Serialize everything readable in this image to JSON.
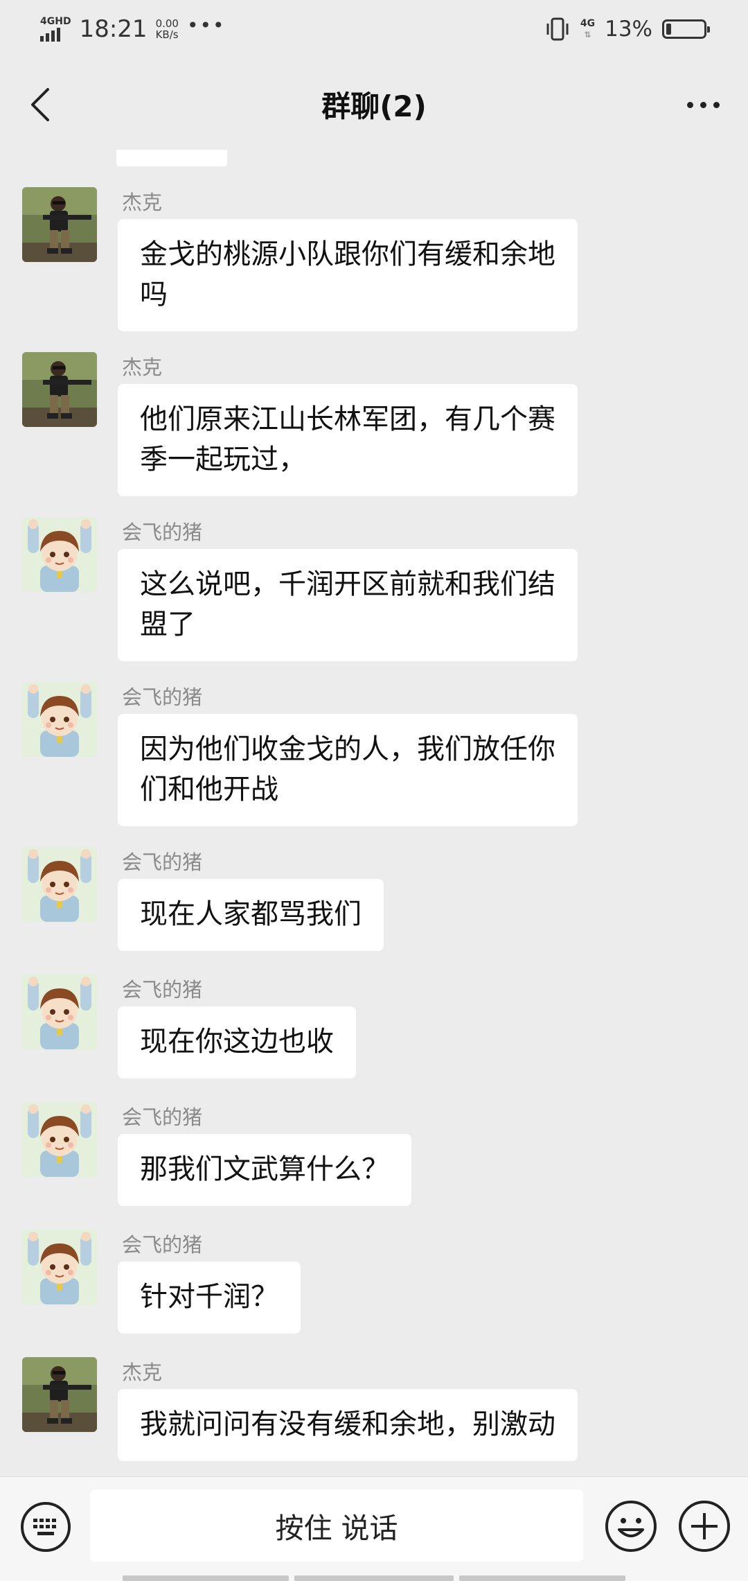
{
  "status_bar": {
    "network_label": "4GHD",
    "time": "18:21",
    "speed_value": "0.00",
    "speed_unit": "KB/s",
    "more_indicator": "•••",
    "mobile_net": "4G",
    "battery_percent": "13%",
    "battery_level": 0.13
  },
  "header": {
    "title": "群聊(2)"
  },
  "messages": [
    {
      "sender": "杰克",
      "avatar": "jack",
      "text_lines": [
        "金戈的桃源小队跟你们有缓和余地",
        "吗"
      ]
    },
    {
      "sender": "杰克",
      "avatar": "jack",
      "text_lines": [
        "他们原来江山长林军团，有几个赛",
        "季一起玩过，"
      ]
    },
    {
      "sender": "会飞的猪",
      "avatar": "pig",
      "text_lines": [
        "这么说吧，千润开区前就和我们结",
        "盟了"
      ]
    },
    {
      "sender": "会飞的猪",
      "avatar": "pig",
      "text_lines": [
        "因为他们收金戈的人，我们放任你",
        "们和他开战"
      ]
    },
    {
      "sender": "会飞的猪",
      "avatar": "pig",
      "text_lines": [
        "现在人家都骂我们"
      ]
    },
    {
      "sender": "会飞的猪",
      "avatar": "pig",
      "text_lines": [
        "现在你这边也收"
      ]
    },
    {
      "sender": "会飞的猪",
      "avatar": "pig",
      "text_lines": [
        "那我们文武算什么？"
      ]
    },
    {
      "sender": "会飞的猪",
      "avatar": "pig",
      "text_lines": [
        "针对千润？"
      ]
    },
    {
      "sender": "杰克",
      "avatar": "jack",
      "text_lines": [
        "我就问问有没有缓和余地，别激动"
      ]
    }
  ],
  "input_bar": {
    "keyboard_icon": "keyboard-icon",
    "hold_to_talk_label": "按住 说话",
    "emoji_icon": "smiley-icon",
    "plus_icon": "plus-icon"
  },
  "colors": {
    "background": "#ececec",
    "bubble": "#ffffff",
    "sender_name": "#8a8a8a"
  }
}
